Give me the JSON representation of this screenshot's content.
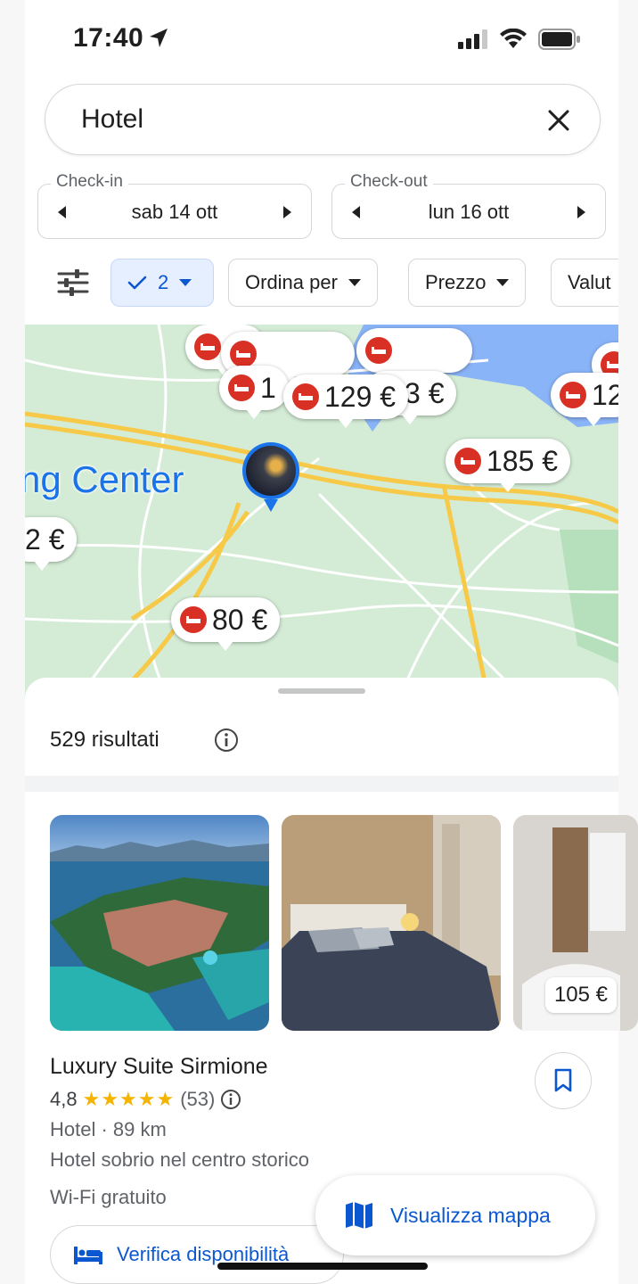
{
  "status_bar": {
    "time": "17:40",
    "icons": [
      "location-arrow-icon",
      "signal-icon",
      "wifi-icon",
      "battery-icon"
    ]
  },
  "search": {
    "query": "Hotel",
    "clear_icon": "close-icon"
  },
  "dates": {
    "checkin": {
      "legend": "Check-in",
      "value": "sab 14 ott"
    },
    "checkout": {
      "legend": "Check-out",
      "value": "lun 16 ott"
    }
  },
  "filters": {
    "guests_value": "2",
    "sort_label": "Ordina per",
    "price_label": "Prezzo",
    "rating_label": "Valut"
  },
  "map": {
    "place_label": "ng Center",
    "pins": {
      "p_1": "1",
      "p_129": "129 €",
      "p_183": "3 €",
      "p_12x": "12",
      "p_185": "185 €",
      "p_2": "2 €",
      "p_80": "80 €"
    }
  },
  "results": {
    "count_text": "529 risultati"
  },
  "listing": {
    "name": "Luxury Suite Sirmione",
    "rating": "4,8",
    "stars": "★★★★★",
    "reviews": "(53)",
    "type_distance": "Hotel · 89 km",
    "description": "Hotel sobrio nel centro storico",
    "amenity": "Wi-Fi gratuito",
    "photo_price": "105 €",
    "verify_label": "Verifica disponibilità"
  },
  "map_button": {
    "label": "Visualizza mappa"
  },
  "colors": {
    "accent": "#0b57d0",
    "hotel_red": "#d93025",
    "star": "#f4b400",
    "map_green": "#cfe9d3",
    "water": "#8ab4f8"
  }
}
